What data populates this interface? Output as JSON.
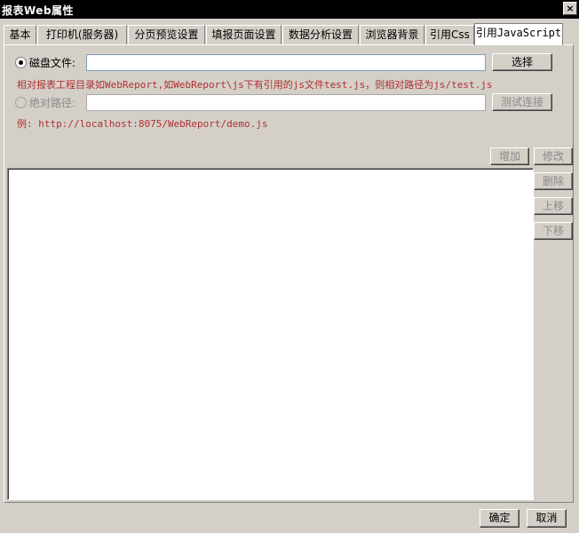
{
  "window": {
    "title": "报表Web属性",
    "close_symbol": "×"
  },
  "tabs": [
    {
      "label": "基本"
    },
    {
      "label": "打印机(服务器)"
    },
    {
      "label": "分页预览设置"
    },
    {
      "label": "填报页面设置"
    },
    {
      "label": "数据分析设置"
    },
    {
      "label": "浏览器背景"
    },
    {
      "label": "引用Css"
    },
    {
      "label": "引用JavaScript"
    }
  ],
  "disk_file": {
    "label": "磁盘文件:",
    "value": "",
    "choose_button": "选择",
    "hint": "相对报表工程目录如WebReport,如WebReport\\js下有引用的js文件test.js，则相对路径为js/test.js"
  },
  "absolute_path": {
    "label": "绝对路径:",
    "value": "",
    "test_button": "测试连接",
    "example": "例: http://localhost:8075/WebReport/demo.js"
  },
  "list_actions": {
    "add": "增加",
    "modify": "修改",
    "delete": "删除",
    "move_up": "上移",
    "move_down": "下移"
  },
  "footer": {
    "ok": "确定",
    "cancel": "取消"
  },
  "colors": {
    "hint_red": "#b03030",
    "titlebar": "#000000",
    "dialog_bg": "#d4d0c8"
  }
}
